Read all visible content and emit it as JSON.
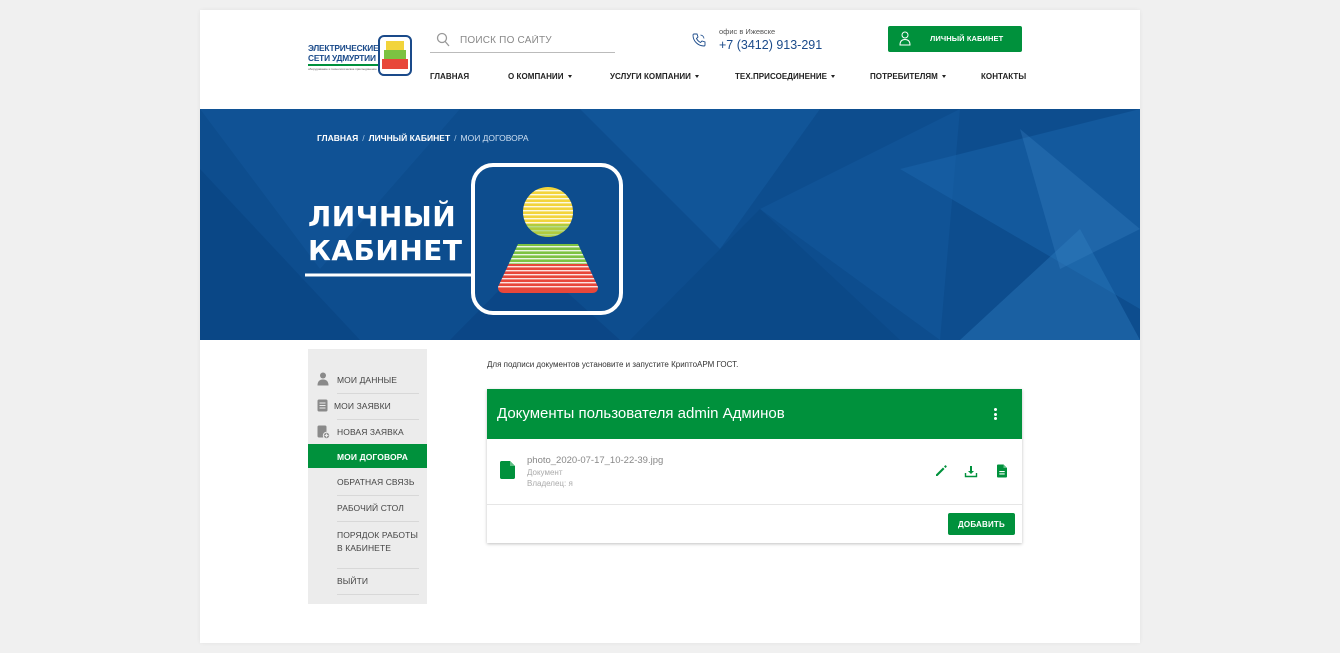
{
  "logo": {
    "line1": "ЭЛЕКТРИЧЕСКИЕ",
    "line2": "СЕТИ УДМУРТИИ",
    "tagline": "оборудование и технологическое присоединение"
  },
  "search": {
    "placeholder": "ПОИСК ПО САЙТУ"
  },
  "contact": {
    "office_label": "офис в Ижевске",
    "phone": "+7 (3412) 913-291"
  },
  "cabinet_button": {
    "label": "ЛИЧНЫЙ КАБИНЕТ"
  },
  "nav": {
    "items": [
      {
        "label": "ГЛАВНАЯ",
        "dropdown": false
      },
      {
        "label": "О КОМПАНИИ",
        "dropdown": true
      },
      {
        "label": "УСЛУГИ КОМПАНИИ",
        "dropdown": true
      },
      {
        "label": "ТЕХ.ПРИСОЕДИНЕНИЕ",
        "dropdown": true
      },
      {
        "label": "ПОТРЕБИТЕЛЯМ",
        "dropdown": true
      },
      {
        "label": "КОНТАКТЫ",
        "dropdown": false
      }
    ]
  },
  "breadcrumb": {
    "home": "ГЛАВНАЯ",
    "cabinet": "ЛИЧНЫЙ КАБИНЕТ",
    "current": "МОИ ДОГОВОРА",
    "separator": "/"
  },
  "banner": {
    "title_line1": "ЛИЧНЫЙ",
    "title_line2": "КАБИНЕТ"
  },
  "sidebar": {
    "items": [
      {
        "label": "МОИ ДАННЫЕ",
        "icon": "user-icon"
      },
      {
        "label": "МОИ ЗАЯВКИ",
        "icon": "document-list-icon"
      },
      {
        "label": "НОВАЯ ЗАЯВКА",
        "icon": "new-document-icon"
      },
      {
        "label": "МОИ ДОГОВОРА",
        "active": true
      },
      {
        "label": "ОБРАТНАЯ СВЯЗЬ"
      },
      {
        "label": "РАБОЧИЙ СТОЛ"
      },
      {
        "label": "ПОРЯДОК РАБОТЫ",
        "label2": "В КАБИНЕТЕ"
      },
      {
        "label": "ВЫЙТИ"
      }
    ]
  },
  "notice": "Для подписи документов установите и запустите КриптоАРМ ГОСТ.",
  "documents": {
    "title": "Документы пользователя admin Админов",
    "files": [
      {
        "name": "photo_2020-07-17_10-22-39.jpg",
        "type": "Документ",
        "owner": "Владелец: я"
      }
    ],
    "actions": [
      "edit-icon",
      "download-icon",
      "file-details-icon"
    ],
    "add_label": "ДОБАВИТЬ"
  },
  "colors": {
    "brand_green": "#00913c",
    "brand_blue": "#1a4a8a",
    "banner_blue": "#0f4f90"
  }
}
